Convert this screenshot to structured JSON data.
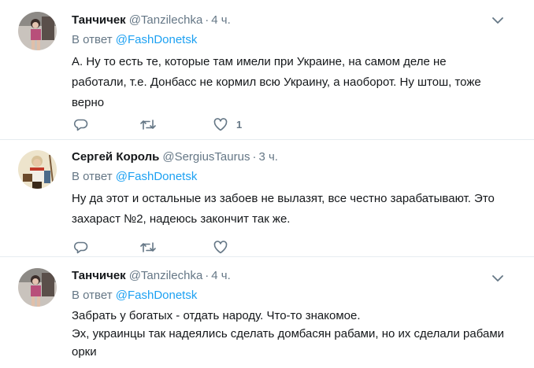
{
  "tweets": [
    {
      "name": "Танчичек",
      "handle": "@Tanzilechka",
      "dot": "·",
      "time": "4 ч.",
      "reply_prefix": "В ответ",
      "reply_to": "@FashDonetsk",
      "text_lines": [
        "А. Ну то есть те, которые там имели при Украине, на самом деле не",
        "работали, т.е. Донбасс не кормил всю Украину, а наоборот. Ну штош, тоже",
        "верно"
      ],
      "like_count": "1",
      "icons": [
        "reply-icon",
        "retweet-icon",
        "like-icon",
        "chevron-down-icon"
      ]
    },
    {
      "name": "Сергей Король",
      "handle": "@SergiusTaurus",
      "dot": "·",
      "time": "3 ч.",
      "reply_prefix": "В ответ",
      "reply_to": "@FashDonetsk",
      "text_lines": [
        "Ну да этот и остальные из забоев не вылазят, все честно зарабатывают. Это",
        "захараст №2, надеюсь закончит так же."
      ],
      "like_count": "",
      "icons": [
        "reply-icon",
        "retweet-icon",
        "like-icon",
        "chevron-down-icon"
      ]
    },
    {
      "name": "Танчичек",
      "handle": "@Tanzilechka",
      "dot": "·",
      "time": "4 ч.",
      "reply_prefix": "В ответ",
      "reply_to": "@FashDonetsk",
      "text_lines": [
        "Забрать у богатых - отдать народу. Что-то знакомое.",
        "Эх, украинцы так надеялись сделать домбасян рабами, но их сделали рабами",
        "орки"
      ],
      "like_count": "",
      "icons": [
        "reply-icon",
        "retweet-icon",
        "like-icon",
        "chevron-down-icon"
      ]
    }
  ],
  "colors": {
    "link": "#1da1f2",
    "secondary": "#657786",
    "divider": "#e6ecf0",
    "text": "#14171a"
  }
}
